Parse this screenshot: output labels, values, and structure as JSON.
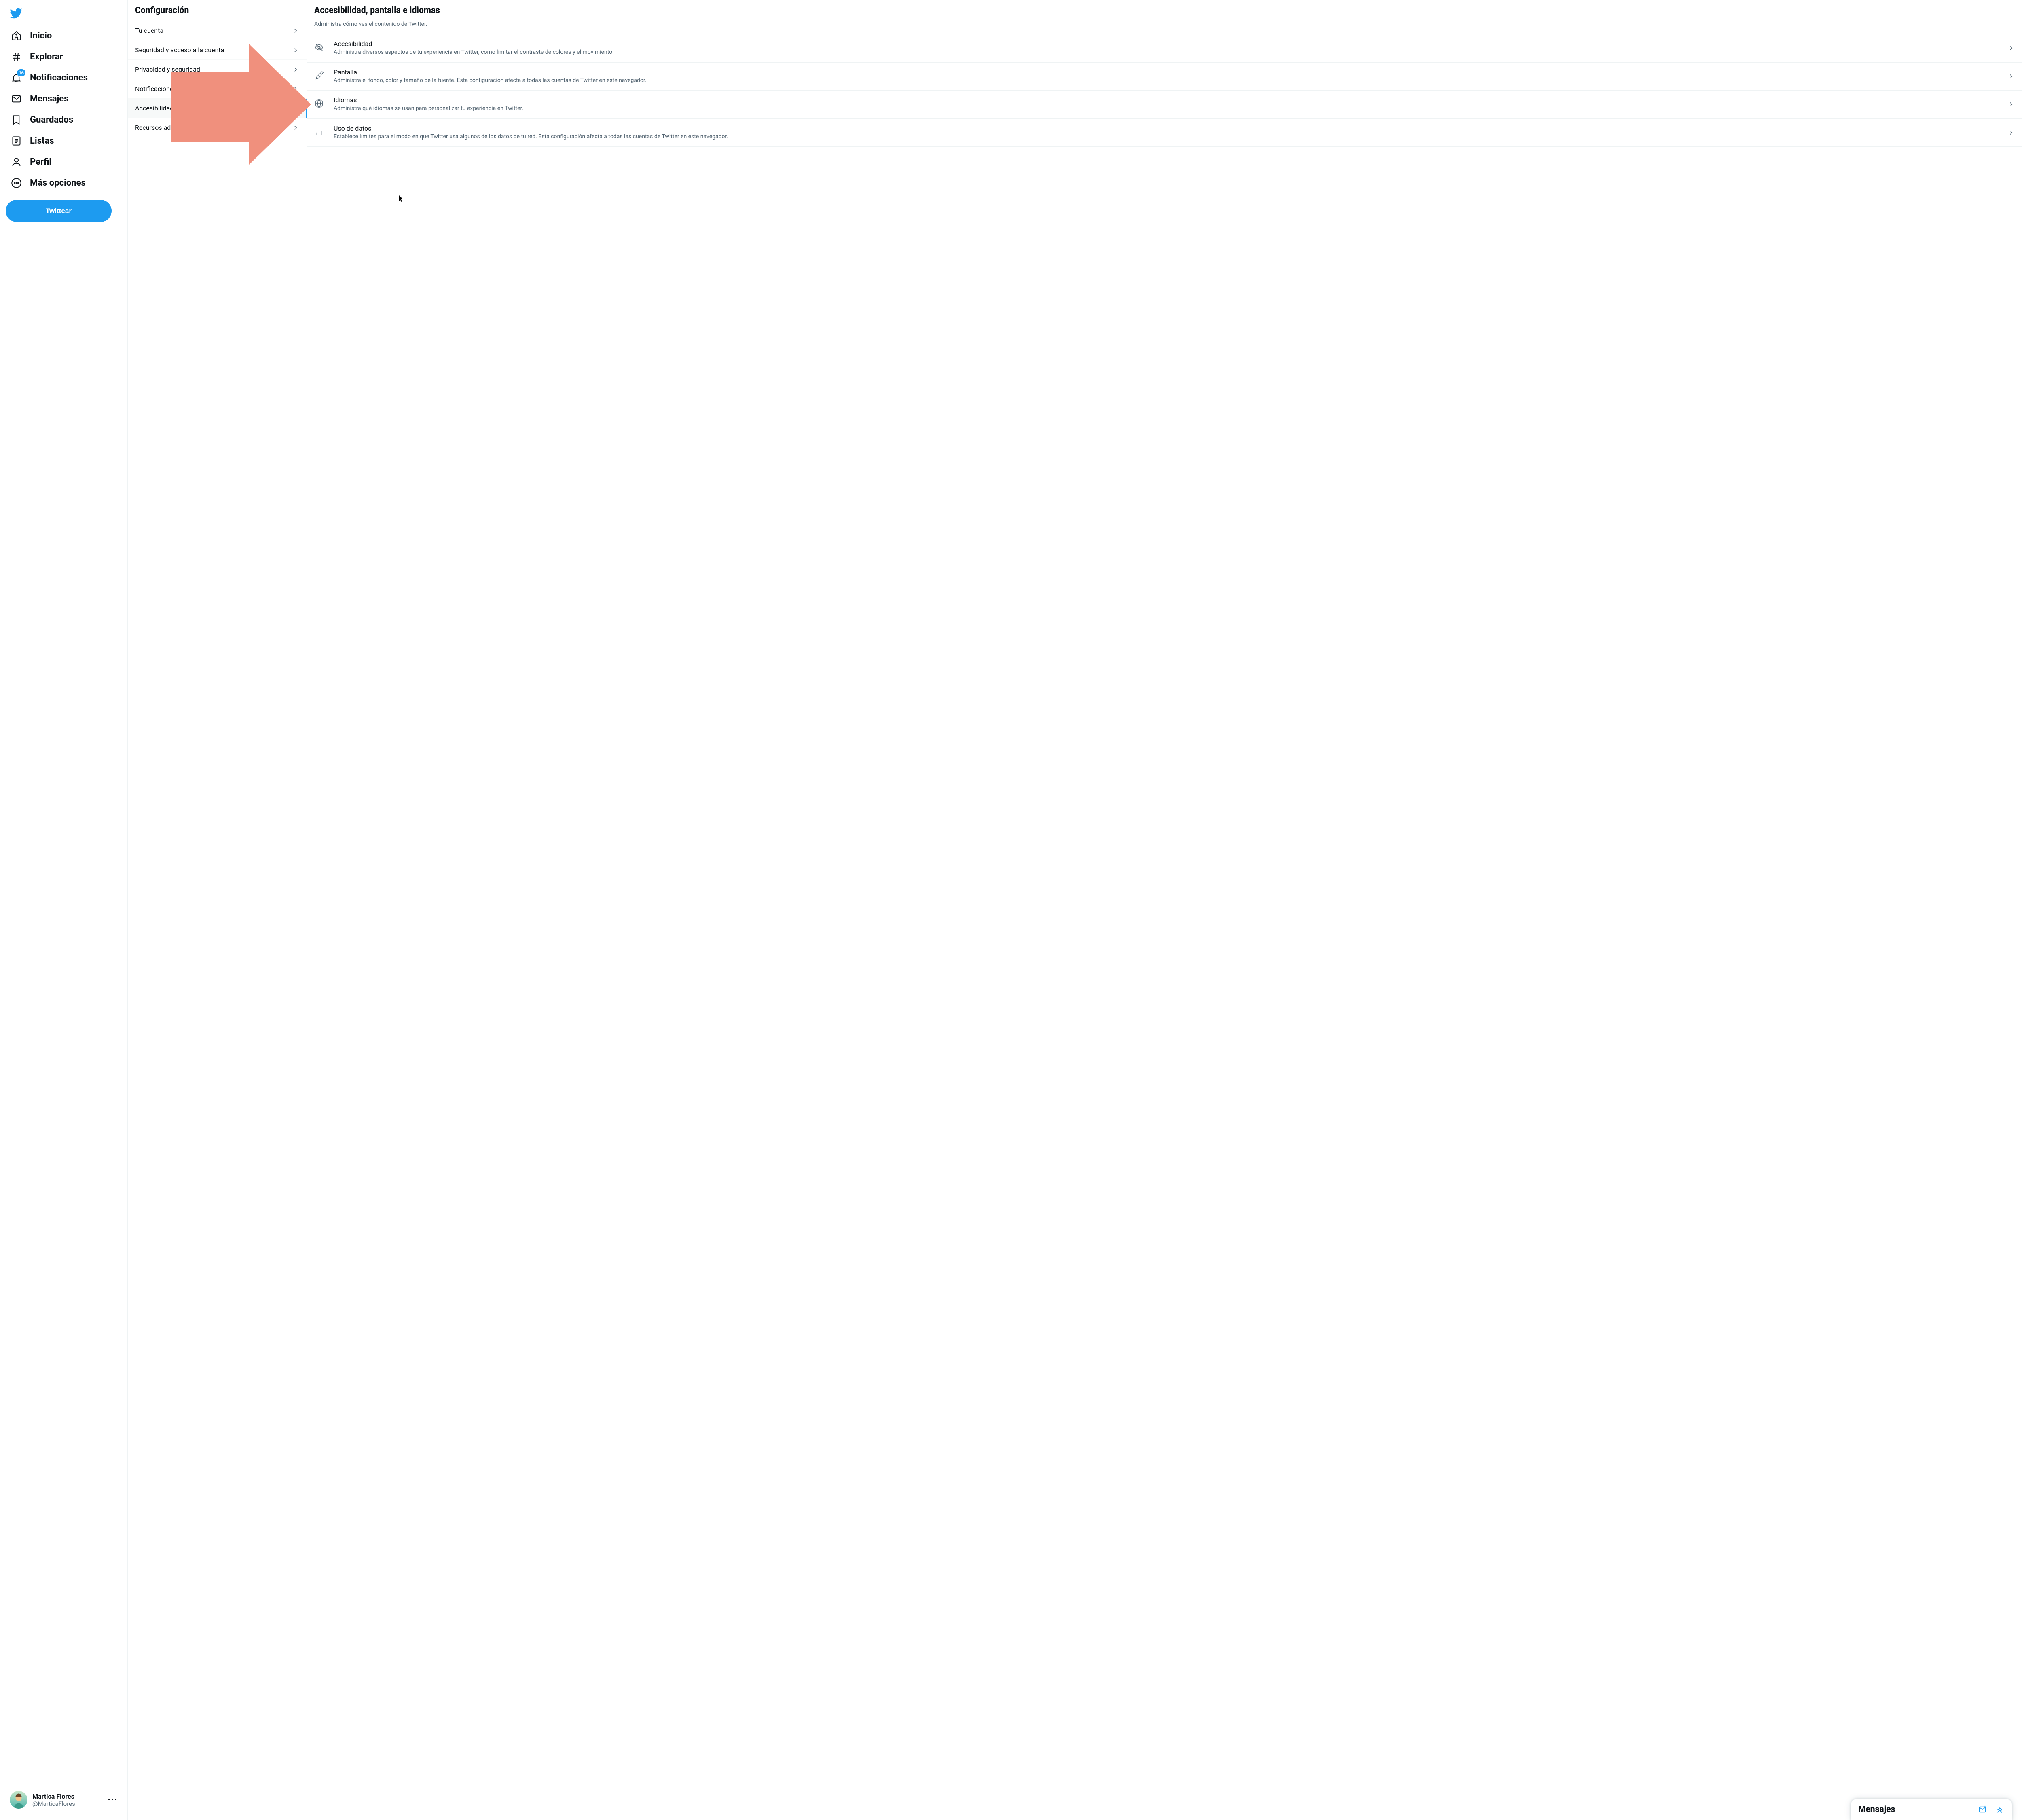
{
  "brand": {
    "accent": "#1d9bf0",
    "arrow_color": "#f0907d"
  },
  "nav": {
    "items": [
      {
        "label": "Inicio"
      },
      {
        "label": "Explorar"
      },
      {
        "label": "Notificaciones",
        "badge": "16"
      },
      {
        "label": "Mensajes"
      },
      {
        "label": "Guardados"
      },
      {
        "label": "Listas"
      },
      {
        "label": "Perfil"
      },
      {
        "label": "Más opciones"
      }
    ],
    "tweet_button": "Twittear"
  },
  "user": {
    "name": "Martica Flores",
    "handle": "@MarticaFlores"
  },
  "settings": {
    "title": "Configuración",
    "rows": [
      {
        "label": "Tu cuenta"
      },
      {
        "label": "Seguridad y acceso a la cuenta"
      },
      {
        "label": "Privacidad y seguridad"
      },
      {
        "label": "Notificaciones"
      },
      {
        "label": "Accesibilidad, pantalla e idiomas",
        "active": true
      },
      {
        "label": "Recursos adicionales"
      }
    ]
  },
  "detail": {
    "title": "Accesibilidad, pantalla e idiomas",
    "description": "Administra cómo ves el contenido de Twitter.",
    "items": [
      {
        "title": "Accesibilidad",
        "sub": "Administra diversos aspectos de tu experiencia en Twitter, como limitar el contraste de colores y el movimiento."
      },
      {
        "title": "Pantalla",
        "sub": "Administra el fondo, color y tamaño de la fuente. Esta configuración afecta a todas las cuentas de Twitter en este navegador."
      },
      {
        "title": "Idiomas",
        "sub": "Administra qué idiomas se usan para personalizar tu experiencia en Twitter."
      },
      {
        "title": "Uso de datos",
        "sub": "Establece límites para el modo en que Twitter usa algunos de los datos de tu red. Esta configuración afecta a todas las cuentas de Twitter en este navegador."
      }
    ]
  },
  "messages_dock": {
    "title": "Mensajes"
  }
}
